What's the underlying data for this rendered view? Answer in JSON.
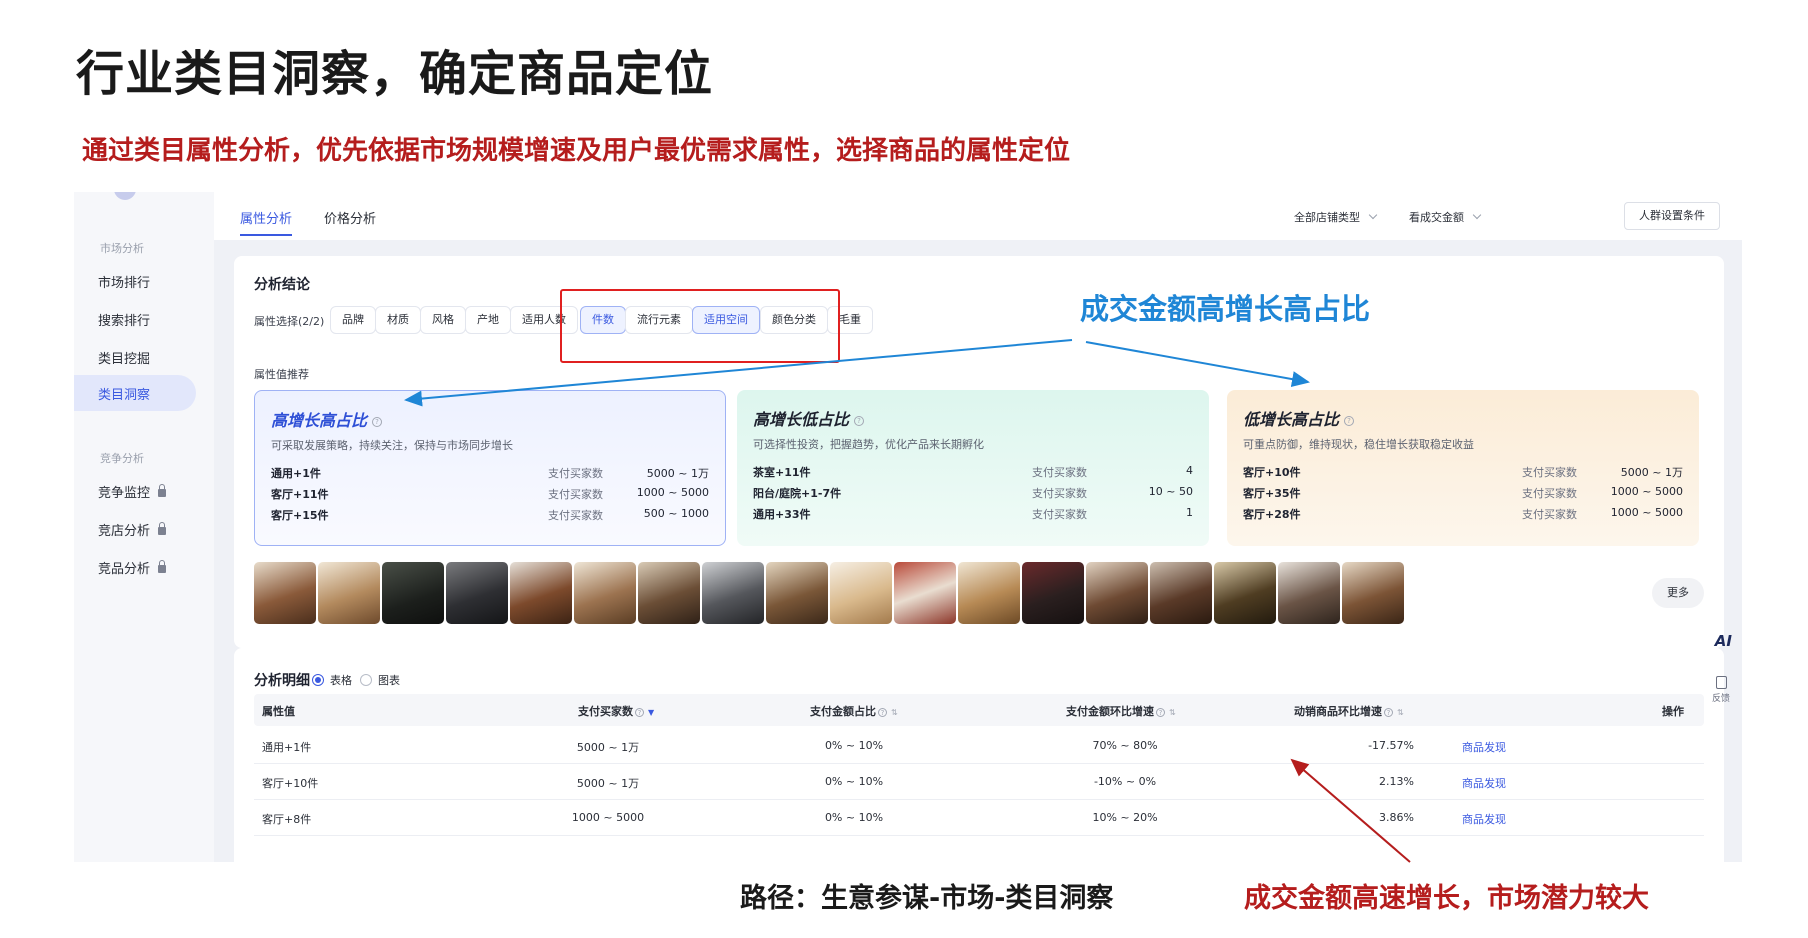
{
  "slide": {
    "title": "行业类目洞察，确定商品定位",
    "subtitle": "通过类目属性分析，优先依据市场规模增速及用户最优需求属性，选择商品的属性定位"
  },
  "annotations": {
    "blue_callout": "成交金额高增长高占比",
    "path": "路径：生意参谋-市场-类目洞察",
    "red_callout": "成交金额高速增长，市场潜力较大"
  },
  "colors": {
    "accent": "#3a59e0",
    "highlight_red": "#e02020",
    "callout_blue": "#1f86d6",
    "callout_red": "#b51d1d"
  },
  "sidebar": {
    "group_market": "市场分析",
    "items": [
      {
        "label": "市场排行"
      },
      {
        "label": "搜索排行"
      },
      {
        "label": "类目挖掘"
      },
      {
        "label": "类目洞察",
        "active": true
      }
    ],
    "group_compete": "竞争分析",
    "locked_items": [
      {
        "label": "竞争监控",
        "icon": "lock-icon"
      },
      {
        "label": "竞店分析",
        "icon": "lock-icon"
      },
      {
        "label": "竞品分析",
        "icon": "lock-icon"
      }
    ]
  },
  "topbar": {
    "tabs": [
      {
        "label": "属性分析",
        "active": true
      },
      {
        "label": "价格分析"
      }
    ],
    "filters": [
      {
        "label": "全部店铺类型",
        "icon": "chevron-down-icon"
      },
      {
        "label": "看成交金额",
        "icon": "chevron-down-icon"
      }
    ],
    "crowd_button": "人群设置条件"
  },
  "analysis": {
    "title": "分析结论",
    "attr_select_label": "属性选择(2/2)",
    "chips": [
      {
        "label": "品牌"
      },
      {
        "label": "材质"
      },
      {
        "label": "风格"
      },
      {
        "label": "产地"
      },
      {
        "label": "适用人数"
      },
      {
        "label": "件数",
        "selected": true
      },
      {
        "label": "流行元素"
      },
      {
        "label": "适用空间",
        "selected": true
      },
      {
        "label": "颜色分类"
      },
      {
        "label": "毛重"
      }
    ],
    "recommend_label": "属性值推荐",
    "cards": [
      {
        "title": "高增长高占比",
        "desc": "可采取发展策略，持续关注，保持与市场同步增长",
        "rows": [
          {
            "attr": "通用+1件",
            "label": "支付买家数",
            "value": "5000 ~ 1万"
          },
          {
            "attr": "客厅+11件",
            "label": "支付买家数",
            "value": "1000 ~ 5000"
          },
          {
            "attr": "客厅+15件",
            "label": "支付买家数",
            "value": "500 ~ 1000"
          }
        ]
      },
      {
        "title": "高增长低占比",
        "desc": "可选择性投资，把握趋势，优化产品来长期孵化",
        "rows": [
          {
            "attr": "茶室+11件",
            "label": "支付买家数",
            "value": "4"
          },
          {
            "attr": "阳台/庭院+1-7件",
            "label": "支付买家数",
            "value": "10 ~ 50"
          },
          {
            "attr": "通用+33件",
            "label": "支付买家数",
            "value": "1"
          }
        ]
      },
      {
        "title": "低增长高占比",
        "desc": "可重点防御，维持现状，稳住增长获取稳定收益",
        "rows": [
          {
            "attr": "客厅+10件",
            "label": "支付买家数",
            "value": "5000 ~ 1万"
          },
          {
            "attr": "客厅+35件",
            "label": "支付买家数",
            "value": "1000 ~ 5000"
          },
          {
            "attr": "客厅+28件",
            "label": "支付买家数",
            "value": "1000 ~ 5000"
          }
        ]
      }
    ],
    "more_button": "更多"
  },
  "detail": {
    "title": "分析明细",
    "views": [
      {
        "label": "表格",
        "selected": true
      },
      {
        "label": "图表"
      }
    ],
    "columns": [
      {
        "label": "属性值"
      },
      {
        "label": "支付买家数",
        "sort": "active"
      },
      {
        "label": "支付金额占比",
        "sort": "idle"
      },
      {
        "label": "支付金额环比增速",
        "sort": "idle"
      },
      {
        "label": "动销商品环比增速",
        "sort": "idle"
      },
      {
        "label": "操作"
      }
    ],
    "rows": [
      {
        "attr": "通用+1件",
        "buyers": "5000 ~ 1万",
        "share": "0% ~ 10%",
        "growth": "70% ~ 80%",
        "sku_growth": "-17.57%",
        "action": "商品发现"
      },
      {
        "attr": "客厅+10件",
        "buyers": "5000 ~ 1万",
        "share": "0% ~ 10%",
        "growth": "-10% ~ 0%",
        "sku_growth": "2.13%",
        "action": "商品发现"
      },
      {
        "attr": "客厅+8件",
        "buyers": "1000 ~ 5000",
        "share": "0% ~ 10%",
        "growth": "10% ~ 20%",
        "sku_growth": "3.86%",
        "action": "商品发现"
      }
    ]
  },
  "widgets": {
    "ai_label": "AI",
    "feedback_label": "反馈"
  }
}
